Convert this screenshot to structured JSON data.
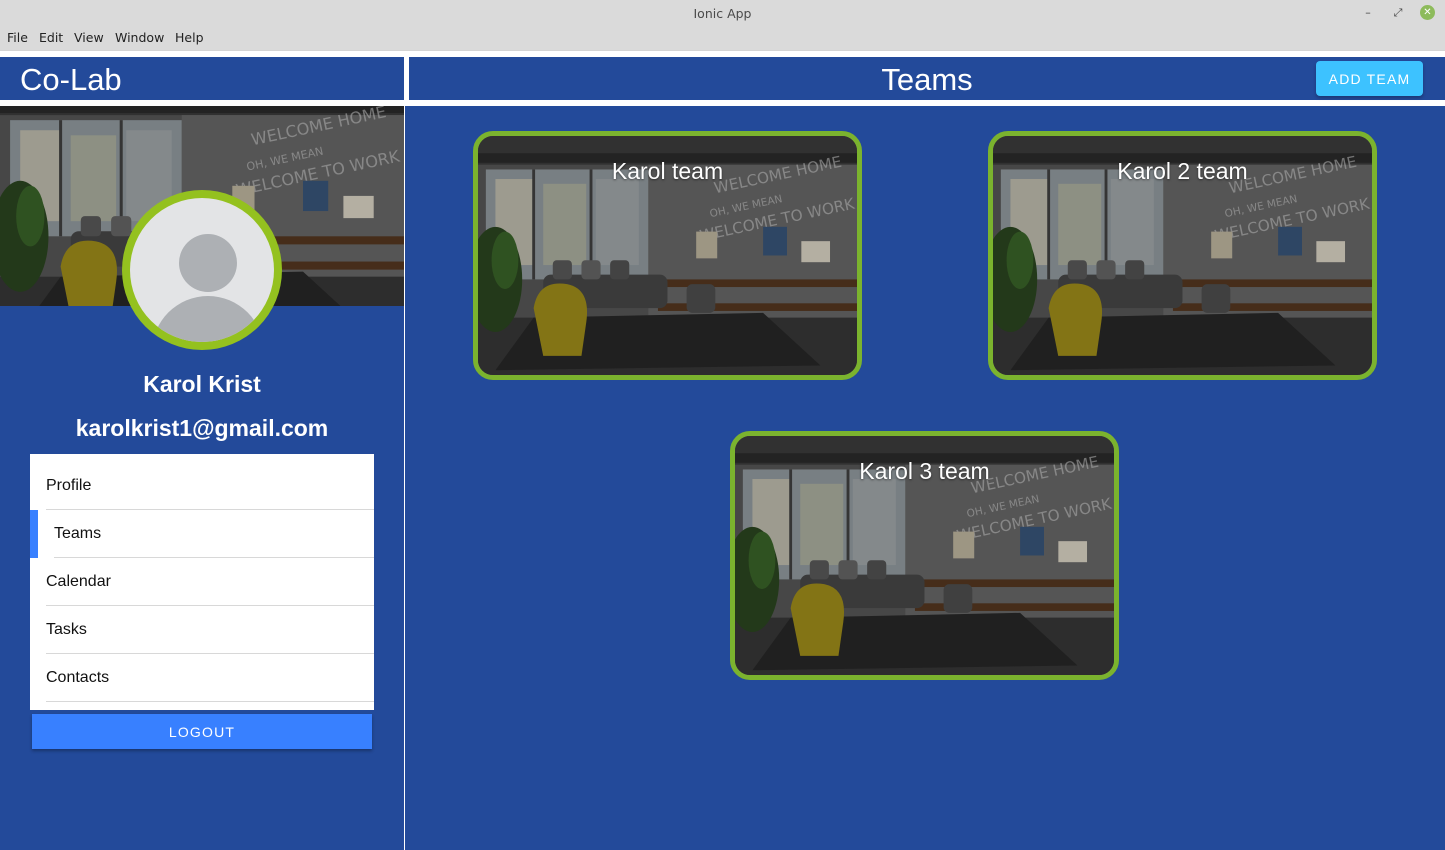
{
  "window": {
    "title": "Ionic App",
    "menu": [
      "File",
      "Edit",
      "View",
      "Window",
      "Help"
    ]
  },
  "app": {
    "brand": "Co-Lab",
    "page_title": "Teams",
    "add_team_label": "ADD TEAM"
  },
  "user": {
    "name": "Karol Krist",
    "email": "karolkrist1@gmail.com"
  },
  "menu": {
    "items": [
      {
        "label": "Profile",
        "active": false
      },
      {
        "label": "Teams",
        "active": true
      },
      {
        "label": "Calendar",
        "active": false
      },
      {
        "label": "Tasks",
        "active": false
      },
      {
        "label": "Contacts",
        "active": false
      }
    ],
    "logout_label": "LOGOUT"
  },
  "teams": [
    {
      "name": "Karol team"
    },
    {
      "name": "Karol 2 team"
    },
    {
      "name": "Karol 3 team"
    }
  ],
  "colors": {
    "primary_bg": "#234a9a",
    "accent_green": "#94c11f",
    "button_blue": "#3880ff",
    "button_cyan": "#3dc2ff"
  }
}
